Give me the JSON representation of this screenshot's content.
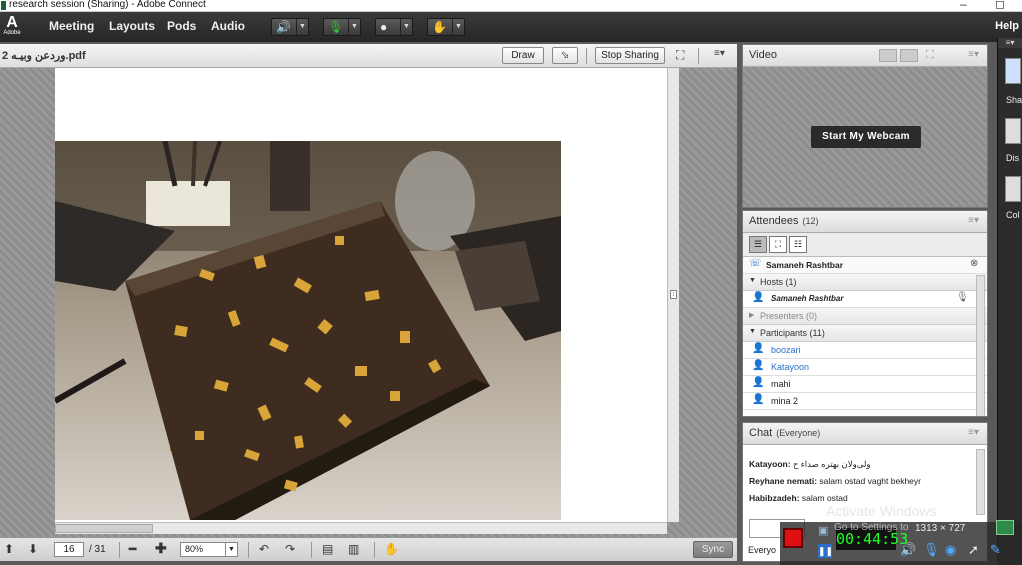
{
  "window": {
    "title": "research session (Sharing) - Adobe Connect",
    "minimize": "–",
    "restore": "◻"
  },
  "menubar": {
    "logo_text": "Adobe",
    "items": [
      "Meeting",
      "Layouts",
      "Pods",
      "Audio"
    ],
    "help": "Help"
  },
  "share": {
    "title": "وردعن وبيـه 2.pdf",
    "draw_label": "Draw",
    "stop_sharing_label": "Stop Sharing",
    "page_current": "16",
    "page_total": "/ 31",
    "zoom": "80%",
    "sync_label": "Sync"
  },
  "video": {
    "title": "Video",
    "start_webcam": "Start My Webcam"
  },
  "attendees": {
    "title": "Attendees",
    "count": "(12)",
    "current_user": "Samaneh Rashtbar",
    "groups": [
      {
        "label": "Hosts (1)",
        "expanded": true
      },
      {
        "label": "Presenters (0)",
        "expanded": false
      },
      {
        "label": "Participants (11)",
        "expanded": true
      }
    ],
    "host": "Samaneh Rashtbar",
    "participants": [
      {
        "name": "boozari",
        "color": "#2a6fc9"
      },
      {
        "name": "Katayoon",
        "color": "#2a6fc9"
      },
      {
        "name": "mahi",
        "color": "#222222"
      },
      {
        "name": "mina 2",
        "color": "#222222"
      }
    ]
  },
  "chat": {
    "title": "Chat",
    "scope": "(Everyone)",
    "messages": [
      {
        "user": "Katayoon:",
        "text": "ولی‌ولان بهتره صداء ح"
      },
      {
        "user": "Reyhane nemati:",
        "text": "salam ostad vaght bekheyr"
      },
      {
        "user": "Habibzadeh:",
        "text": "salam ostad"
      }
    ],
    "audience": "Everyo"
  },
  "dock": {
    "labels": [
      "Sha",
      "Dis",
      "Col"
    ]
  },
  "recorder": {
    "time": "00:44:53",
    "size": "1313 × 727"
  },
  "watermark": {
    "line1": "Activate Windows",
    "line2": "Go to Settings to"
  },
  "colors": {
    "menubar": "#2f2f2f",
    "host_icon": "#d9a400",
    "participant_icon": "#2a6fc9",
    "webcam_button": "#2a2a2a",
    "record_red": "#dd1111",
    "timer_green": "#22ff22"
  }
}
